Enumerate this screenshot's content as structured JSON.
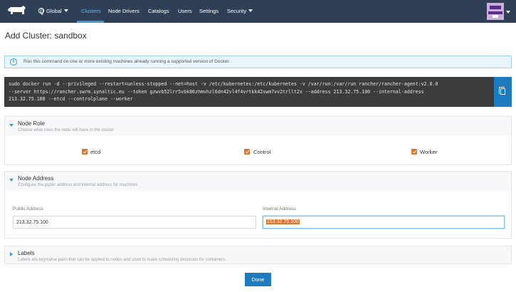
{
  "nav": {
    "logo_icon": "rancher-cow-logo-icon",
    "cluster_selector": "Global",
    "items": [
      "Clusters",
      "Node Drivers",
      "Catalogs",
      "Users",
      "Settings",
      "Security"
    ],
    "active": "Clusters"
  },
  "page": {
    "title": "Add Cluster: sandbox"
  },
  "info": {
    "text": "Run this command on one or more existing machines already running a supported version of Docker."
  },
  "command": {
    "lines": [
      "sudo docker run -d --privileged --restart=unless-stopped --net=host -v /etc/kubernetes:/etc/kubernetes -v /var/run:/var/run rancher/rancher-agent:v2.0.0",
      "--server https://rancher.swrm.synaltic.eu --token gzwvb52lrr5vbk86zhmvhzl6dn42vl4f4vrtkk42swm7vv2trllt2x --address 213.32.75.100 --internal-address",
      "213.32.75.100 --etcd --controlplane --worker"
    ]
  },
  "node_role": {
    "title": "Node Role",
    "subtitle": "Choose what roles the node will have in the cluster",
    "roles": [
      {
        "label": "etcd",
        "checked": true
      },
      {
        "label": "Control",
        "checked": true
      },
      {
        "label": "Worker",
        "checked": true
      }
    ]
  },
  "node_address": {
    "title": "Node Address",
    "subtitle": "Configure the public address and internal address for machines",
    "public_label": "Public Address",
    "public_value": "213.32.75.100",
    "internal_label": "Internal Address",
    "internal_value": "213.32.75.100"
  },
  "labels": {
    "title": "Labels",
    "subtitle": "Labels are key/value pairs that can be applied to nodes and used to make scheduling decisions for containers."
  },
  "actions": {
    "done": "Done"
  },
  "colors": {
    "nav_bg": "#2f3f55",
    "accent": "#1f7bbf",
    "checkbox": "#e0742c"
  }
}
